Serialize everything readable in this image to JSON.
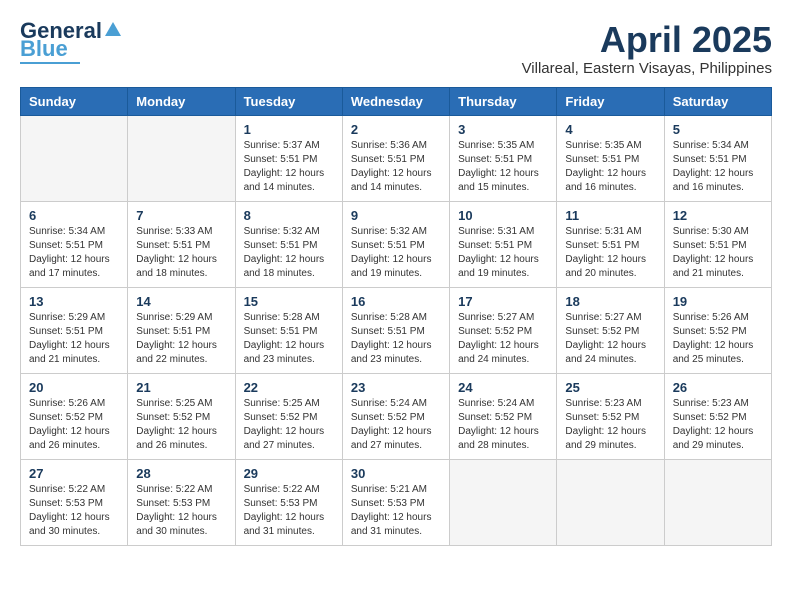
{
  "header": {
    "logo_line1": "General",
    "logo_line2": "Blue",
    "month_year": "April 2025",
    "location": "Villareal, Eastern Visayas, Philippines"
  },
  "weekdays": [
    "Sunday",
    "Monday",
    "Tuesday",
    "Wednesday",
    "Thursday",
    "Friday",
    "Saturday"
  ],
  "weeks": [
    [
      {
        "day": "",
        "info": ""
      },
      {
        "day": "",
        "info": ""
      },
      {
        "day": "1",
        "info": "Sunrise: 5:37 AM\nSunset: 5:51 PM\nDaylight: 12 hours\nand 14 minutes."
      },
      {
        "day": "2",
        "info": "Sunrise: 5:36 AM\nSunset: 5:51 PM\nDaylight: 12 hours\nand 14 minutes."
      },
      {
        "day": "3",
        "info": "Sunrise: 5:35 AM\nSunset: 5:51 PM\nDaylight: 12 hours\nand 15 minutes."
      },
      {
        "day": "4",
        "info": "Sunrise: 5:35 AM\nSunset: 5:51 PM\nDaylight: 12 hours\nand 16 minutes."
      },
      {
        "day": "5",
        "info": "Sunrise: 5:34 AM\nSunset: 5:51 PM\nDaylight: 12 hours\nand 16 minutes."
      }
    ],
    [
      {
        "day": "6",
        "info": "Sunrise: 5:34 AM\nSunset: 5:51 PM\nDaylight: 12 hours\nand 17 minutes."
      },
      {
        "day": "7",
        "info": "Sunrise: 5:33 AM\nSunset: 5:51 PM\nDaylight: 12 hours\nand 18 minutes."
      },
      {
        "day": "8",
        "info": "Sunrise: 5:32 AM\nSunset: 5:51 PM\nDaylight: 12 hours\nand 18 minutes."
      },
      {
        "day": "9",
        "info": "Sunrise: 5:32 AM\nSunset: 5:51 PM\nDaylight: 12 hours\nand 19 minutes."
      },
      {
        "day": "10",
        "info": "Sunrise: 5:31 AM\nSunset: 5:51 PM\nDaylight: 12 hours\nand 19 minutes."
      },
      {
        "day": "11",
        "info": "Sunrise: 5:31 AM\nSunset: 5:51 PM\nDaylight: 12 hours\nand 20 minutes."
      },
      {
        "day": "12",
        "info": "Sunrise: 5:30 AM\nSunset: 5:51 PM\nDaylight: 12 hours\nand 21 minutes."
      }
    ],
    [
      {
        "day": "13",
        "info": "Sunrise: 5:29 AM\nSunset: 5:51 PM\nDaylight: 12 hours\nand 21 minutes."
      },
      {
        "day": "14",
        "info": "Sunrise: 5:29 AM\nSunset: 5:51 PM\nDaylight: 12 hours\nand 22 minutes."
      },
      {
        "day": "15",
        "info": "Sunrise: 5:28 AM\nSunset: 5:51 PM\nDaylight: 12 hours\nand 23 minutes."
      },
      {
        "day": "16",
        "info": "Sunrise: 5:28 AM\nSunset: 5:51 PM\nDaylight: 12 hours\nand 23 minutes."
      },
      {
        "day": "17",
        "info": "Sunrise: 5:27 AM\nSunset: 5:52 PM\nDaylight: 12 hours\nand 24 minutes."
      },
      {
        "day": "18",
        "info": "Sunrise: 5:27 AM\nSunset: 5:52 PM\nDaylight: 12 hours\nand 24 minutes."
      },
      {
        "day": "19",
        "info": "Sunrise: 5:26 AM\nSunset: 5:52 PM\nDaylight: 12 hours\nand 25 minutes."
      }
    ],
    [
      {
        "day": "20",
        "info": "Sunrise: 5:26 AM\nSunset: 5:52 PM\nDaylight: 12 hours\nand 26 minutes."
      },
      {
        "day": "21",
        "info": "Sunrise: 5:25 AM\nSunset: 5:52 PM\nDaylight: 12 hours\nand 26 minutes."
      },
      {
        "day": "22",
        "info": "Sunrise: 5:25 AM\nSunset: 5:52 PM\nDaylight: 12 hours\nand 27 minutes."
      },
      {
        "day": "23",
        "info": "Sunrise: 5:24 AM\nSunset: 5:52 PM\nDaylight: 12 hours\nand 27 minutes."
      },
      {
        "day": "24",
        "info": "Sunrise: 5:24 AM\nSunset: 5:52 PM\nDaylight: 12 hours\nand 28 minutes."
      },
      {
        "day": "25",
        "info": "Sunrise: 5:23 AM\nSunset: 5:52 PM\nDaylight: 12 hours\nand 29 minutes."
      },
      {
        "day": "26",
        "info": "Sunrise: 5:23 AM\nSunset: 5:52 PM\nDaylight: 12 hours\nand 29 minutes."
      }
    ],
    [
      {
        "day": "27",
        "info": "Sunrise: 5:22 AM\nSunset: 5:53 PM\nDaylight: 12 hours\nand 30 minutes."
      },
      {
        "day": "28",
        "info": "Sunrise: 5:22 AM\nSunset: 5:53 PM\nDaylight: 12 hours\nand 30 minutes."
      },
      {
        "day": "29",
        "info": "Sunrise: 5:22 AM\nSunset: 5:53 PM\nDaylight: 12 hours\nand 31 minutes."
      },
      {
        "day": "30",
        "info": "Sunrise: 5:21 AM\nSunset: 5:53 PM\nDaylight: 12 hours\nand 31 minutes."
      },
      {
        "day": "",
        "info": ""
      },
      {
        "day": "",
        "info": ""
      },
      {
        "day": "",
        "info": ""
      }
    ]
  ]
}
